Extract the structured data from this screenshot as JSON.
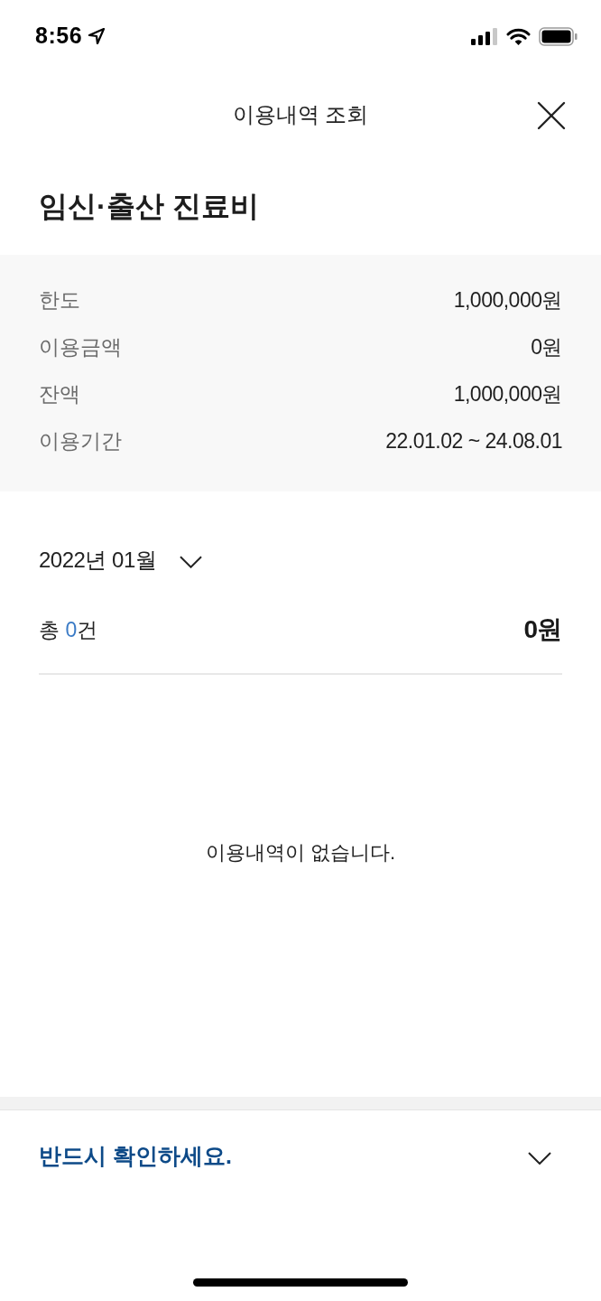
{
  "status_bar": {
    "time": "8:56"
  },
  "header": {
    "title": "이용내역 조회"
  },
  "page_title": "임신·출산 진료비",
  "summary_rows": [
    {
      "label": "한도",
      "value": "1,000,000원"
    },
    {
      "label": "이용금액",
      "value": "0원"
    },
    {
      "label": "잔액",
      "value": "1,000,000원"
    },
    {
      "label": "이용기간",
      "value": "22.01.02 ~ 24.08.01"
    }
  ],
  "month_selector": {
    "label": "2022년 01월",
    "expanded": false
  },
  "totals": {
    "count_prefix": "총",
    "count": "0",
    "count_suffix": "건",
    "amount": "0원"
  },
  "empty_message": "이용내역이 없습니다.",
  "notice": {
    "title": "반드시 확인하세요.",
    "expanded": false
  }
}
